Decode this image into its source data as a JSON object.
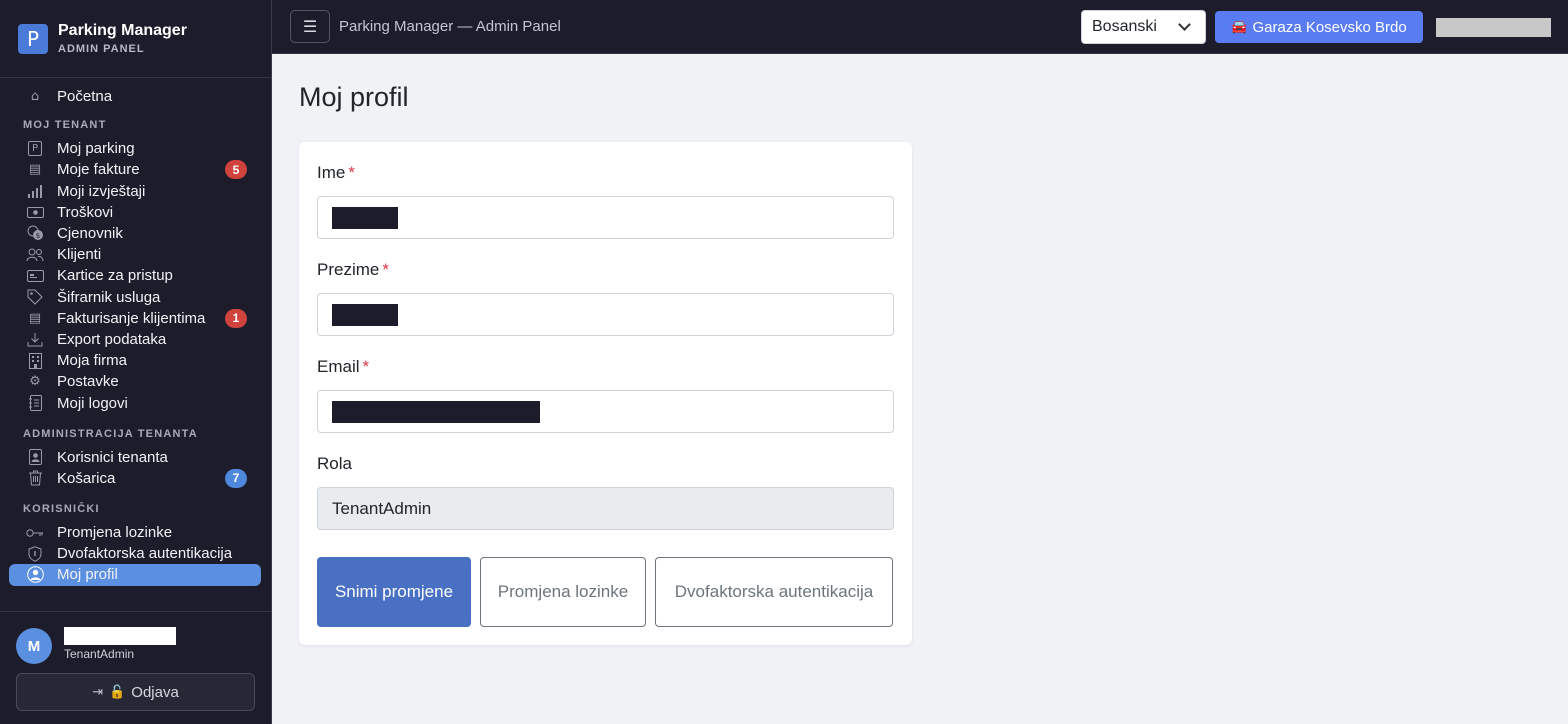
{
  "brand": {
    "logo_letter": "P",
    "title": "Parking Manager",
    "subtitle": "ADMIN PANEL"
  },
  "sidebar": {
    "home": {
      "icon": "home-icon",
      "label": "Početna"
    },
    "sections": [
      {
        "title": "MOJ TENANT"
      },
      {
        "title": "ADMINISTRACIJA TENANTA"
      },
      {
        "title": "KORISNIČKI"
      }
    ],
    "tenant_items": [
      {
        "icon": "parking-icon",
        "label": "Moj parking"
      },
      {
        "icon": "invoice-icon",
        "label": "Moje fakture",
        "badge": "5"
      },
      {
        "icon": "bar-chart-icon",
        "label": "Moji izvještaji"
      },
      {
        "icon": "cash-icon",
        "label": "Troškovi"
      },
      {
        "icon": "coins-icon",
        "label": "Cjenovnik"
      },
      {
        "icon": "people-icon",
        "label": "Klijenti"
      },
      {
        "icon": "card-icon",
        "label": "Kartice za pristup"
      },
      {
        "icon": "tag-icon",
        "label": "Šifrarnik usluga"
      },
      {
        "icon": "receipt-icon",
        "label": "Fakturisanje klijentima",
        "badge": "1"
      },
      {
        "icon": "download-icon",
        "label": "Export podataka"
      },
      {
        "icon": "building-icon",
        "label": "Moja firma"
      },
      {
        "icon": "gear-icon",
        "label": "Postavke"
      },
      {
        "icon": "journal-icon",
        "label": "Moji logovi"
      }
    ],
    "admin_items": [
      {
        "icon": "person-badge-icon",
        "label": "Korisnici tenanta"
      },
      {
        "icon": "trash-icon",
        "label": "Košarica",
        "badge": "7"
      }
    ],
    "user_items": [
      {
        "icon": "key-icon",
        "label": "Promjena lozinke"
      },
      {
        "icon": "shield-icon",
        "label": "Dvofaktorska autentikacija"
      },
      {
        "icon": "user-circle-icon",
        "label": "Moj profil"
      }
    ],
    "footer": {
      "avatar_letter": "M",
      "role": "TenantAdmin",
      "logout_label": "Odjava"
    }
  },
  "header": {
    "title": "Parking Manager — Admin Panel",
    "language": "Bosanski",
    "garage_button": "Garaza Kosevsko Brdo"
  },
  "main": {
    "page_title": "Moj profil",
    "form": {
      "first_name_label": "Ime",
      "last_name_label": "Prezime",
      "email_label": "Email",
      "role_label": "Rola",
      "role_value": "TenantAdmin",
      "required_mark": "*"
    },
    "buttons": {
      "save": "Snimi promjene",
      "change_password": "Promjena lozinke",
      "two_factor": "Dvofaktorska autentikacija"
    }
  },
  "colors": {
    "sidebar_bg": "#1c1c2a",
    "accent": "#5b8fe0",
    "garage_button": "#5a7cf2",
    "primary_button": "#4a70c4",
    "badge_red": "#d0433d",
    "badge_blue": "#4f87dc"
  }
}
